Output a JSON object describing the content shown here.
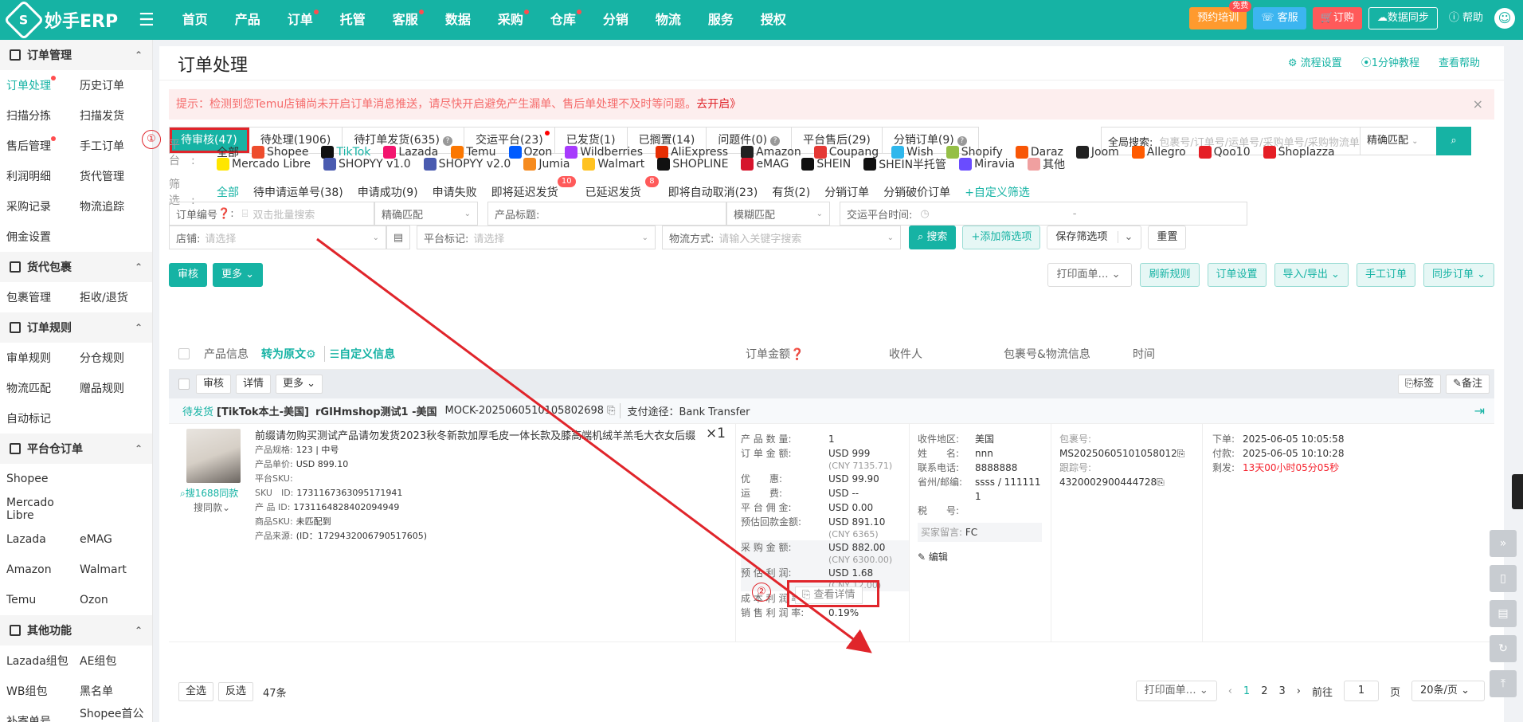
{
  "brand": {
    "name": "妙手ERP"
  },
  "topnav": [
    {
      "label": "首页",
      "dot": false
    },
    {
      "label": "产品",
      "dot": false
    },
    {
      "label": "订单",
      "dot": true
    },
    {
      "label": "托管",
      "dot": false
    },
    {
      "label": "客服",
      "dot": true
    },
    {
      "label": "数据",
      "dot": false
    },
    {
      "label": "采购",
      "dot": true
    },
    {
      "label": "仓库",
      "dot": true
    },
    {
      "label": "分销",
      "dot": false
    },
    {
      "label": "物流",
      "dot": false
    },
    {
      "label": "服务",
      "dot": false
    },
    {
      "label": "授权",
      "dot": false
    }
  ],
  "topright": {
    "training": "预约培训",
    "training_badge": "免费",
    "service": "客服",
    "subscribe": "订购",
    "sync": "数据同步",
    "help": "帮助"
  },
  "sidebar": {
    "groups": [
      {
        "title": "订单管理",
        "rows": [
          [
            "订单处理",
            "历史订单"
          ],
          [
            "扫描分拣",
            "扫描发货"
          ],
          [
            "售后管理",
            "手工订单"
          ],
          [
            "利润明细",
            "货代管理"
          ],
          [
            "采购记录",
            "物流追踪"
          ],
          [
            "佣金设置",
            ""
          ]
        ]
      },
      {
        "title": "货代包裹",
        "rows": [
          [
            "包裹管理",
            "拒收/退货"
          ]
        ]
      },
      {
        "title": "订单规则",
        "rows": [
          [
            "审单规则",
            "分仓规则"
          ],
          [
            "物流匹配",
            "赠品规则"
          ],
          [
            "自动标记",
            ""
          ]
        ]
      },
      {
        "title": "平台仓订单",
        "rows": [
          [
            "Shopee",
            ""
          ],
          [
            "Mercado Libre",
            ""
          ],
          [
            "Lazada",
            "eMAG"
          ],
          [
            "Amazon",
            "Walmart"
          ],
          [
            "Temu",
            "Ozon"
          ]
        ]
      },
      {
        "title": "其他功能",
        "rows": [
          [
            "Lazada组包",
            "AE组包"
          ],
          [
            "WB组包",
            "黑名单"
          ],
          [
            "补寄单号",
            "Shopee首公里"
          ]
        ]
      }
    ]
  },
  "page": {
    "title": "订单处理",
    "links": [
      "流程设置",
      "1分钟教程",
      "查看帮助"
    ],
    "alert_text": "提示：检测到您Temu店铺尚未开启订单消息推送，请尽快开启避免产生漏单、售后单处理不及时等问题。",
    "alert_link": "去开启》",
    "alert_close": "×"
  },
  "tabs": [
    {
      "label": "待审核(47)",
      "active": true,
      "q": false,
      "dot": false
    },
    {
      "label": "待处理(1906)",
      "active": false,
      "q": false,
      "dot": false
    },
    {
      "label": "待打单发货(635)",
      "active": false,
      "q": true,
      "dot": false
    },
    {
      "label": "交运平台(23)",
      "active": false,
      "q": false,
      "dot": true
    },
    {
      "label": "已发货(1)",
      "active": false,
      "q": false,
      "dot": false
    },
    {
      "label": "已搁置(14)",
      "active": false,
      "q": false,
      "dot": false
    },
    {
      "label": "问题件(0)",
      "active": false,
      "q": true,
      "dot": false
    },
    {
      "label": "平台售后(29)",
      "active": false,
      "q": false,
      "dot": false
    },
    {
      "label": "分销订单(9)",
      "active": false,
      "q": true,
      "dot": false
    }
  ],
  "markers": {
    "one": "①",
    "two": "②"
  },
  "global_search": {
    "label": "全局搜索:",
    "placeholder": "包裹号/订单号/运单号/采购单号/采购物流单号",
    "match": "精确匹配"
  },
  "platforms": {
    "label": "平台:",
    "row1": [
      {
        "name": "全部",
        "color": "",
        "active": false
      },
      {
        "name": "Shopee",
        "color": "#ee4d2d",
        "active": false
      },
      {
        "name": "TikTok",
        "color": "#111111",
        "active": true
      },
      {
        "name": "Lazada",
        "color": "#f3156e",
        "active": false
      },
      {
        "name": "Temu",
        "color": "#fb7701",
        "active": false
      },
      {
        "name": "Ozon",
        "color": "#005bff",
        "active": false
      },
      {
        "name": "Wildberries",
        "color": "#a73afd",
        "active": false
      },
      {
        "name": "AliExpress",
        "color": "#e62e04",
        "active": false
      },
      {
        "name": "Amazon",
        "color": "#222222",
        "active": false
      },
      {
        "name": "Coupang",
        "color": "#e53935",
        "active": false
      },
      {
        "name": "Wish",
        "color": "#2fb7ec",
        "active": false
      },
      {
        "name": "Shopify",
        "color": "#95bf47",
        "active": false
      },
      {
        "name": "Daraz",
        "color": "#f85606",
        "active": false
      },
      {
        "name": "Joom",
        "color": "#222222",
        "active": false
      },
      {
        "name": "Allegro",
        "color": "#ff5a00",
        "active": false
      },
      {
        "name": "Qoo10",
        "color": "#e51e25",
        "active": false
      },
      {
        "name": "Shoplazza",
        "color": "#e51e25",
        "active": false
      }
    ],
    "row2": [
      {
        "name": "Mercado Libre",
        "color": "#ffe600"
      },
      {
        "name": "SHOPYY v1.0",
        "color": "#4a5bb0"
      },
      {
        "name": "SHOPYY v2.0",
        "color": "#4a5bb0"
      },
      {
        "name": "Jumia",
        "color": "#f68b1e"
      },
      {
        "name": "Walmart",
        "color": "#ffc220"
      },
      {
        "name": "SHOPLINE",
        "color": "#111111"
      },
      {
        "name": "eMAG",
        "color": "#d6142c"
      },
      {
        "name": "SHEIN",
        "color": "#111111"
      },
      {
        "name": "SHEIN半托管",
        "color": "#111111"
      },
      {
        "name": "Miravia",
        "color": "#6a4cff"
      },
      {
        "name": "其他",
        "color": "#f0a0a0"
      }
    ]
  },
  "filters": {
    "label": "筛选:",
    "items": [
      {
        "label": "全部",
        "active": true,
        "count": ""
      },
      {
        "label": "待申请运单号(38)",
        "active": false,
        "count": ""
      },
      {
        "label": "申请成功(9)",
        "active": false,
        "count": ""
      },
      {
        "label": "申请失败",
        "active": false,
        "count": ""
      },
      {
        "label": "即将延迟发货",
        "active": false,
        "count": "10"
      },
      {
        "label": "已延迟发货",
        "active": false,
        "count": "8"
      },
      {
        "label": "即将自动取消(23)",
        "active": false,
        "count": ""
      },
      {
        "label": "有货(2)",
        "active": false,
        "count": ""
      },
      {
        "label": "分销订单",
        "active": false,
        "count": ""
      },
      {
        "label": "分销破价订单",
        "active": false,
        "count": ""
      }
    ],
    "custom": "+自定义筛选"
  },
  "search_row1": {
    "order_no": "订单编号",
    "batch_ph": "双击批量搜索",
    "exact": "精确匹配",
    "title_label": "产品标题:",
    "fuzzy": "模糊匹配",
    "time_label": "交运平台时间:",
    "dash": "-"
  },
  "search_row2": {
    "store": "店铺:",
    "store_ph": "请选择",
    "mark": "平台标记:",
    "mark_ph": "请选择",
    "ship": "物流方式:",
    "ship_ph": "请输入关键字搜索",
    "search": "搜索",
    "add_filter": "+添加筛选项",
    "save_filter": "保存筛选项",
    "reset": "重置"
  },
  "toolbar": {
    "audit": "审核",
    "more": "更多",
    "print": "打印面单…",
    "refresh_rules": "刷新规则",
    "order_settings": "订单设置",
    "import_export": "导入/导出",
    "manual": "手工订单",
    "sync_orders": "同步订单"
  },
  "table_head": {
    "product": "产品信息",
    "translate": "转为原文",
    "custom_info": "自定义信息",
    "amount": "订单金额",
    "receiver": "收件人",
    "package": "包裹号&物流信息",
    "time": "时间"
  },
  "sub_head": {
    "audit": "审核",
    "detail": "详情",
    "more": "更多",
    "tag": "标签",
    "remark": "备注"
  },
  "order": {
    "status": "待发货",
    "store": "[TikTok本土-美国]",
    "shop_name": "rGIHmshop测试1 -美国",
    "order_no": "MOCK-2025060510105802698",
    "payment": "支付途径：Bank Transfer",
    "product_title": "前缀请勿购买测试产品请勿发货2023秋冬新款加厚毛皮一体长款及膝高端机绒羊羔毛大衣女后缀",
    "qty": "×1",
    "find_1688": "搜1688同款",
    "same": "搜同款",
    "specs": [
      {
        "k": "产品规格:",
        "v": "123 | 中号"
      },
      {
        "k": "产品单价:",
        "v": "USD 899.10"
      },
      {
        "k": "平台SKU:",
        "v": ""
      },
      {
        "k": "SKU　ID:",
        "v": "1731167363095171941"
      },
      {
        "k": "产 品 ID:",
        "v": "1731164828402094949"
      },
      {
        "k": "商品SKU:",
        "v": "未匹配到"
      },
      {
        "k": "产品来源:",
        "v": "(ID：1729432006790517605)"
      }
    ],
    "amounts": [
      {
        "k": "产 品 数 量:",
        "v": "1",
        "sub": ""
      },
      {
        "k": "订 单 金 额:",
        "v": "USD 999",
        "sub": "(CNY 7135.71)"
      },
      {
        "k": "优　　惠:",
        "v": "USD 99.90",
        "sub": ""
      },
      {
        "k": "运　　费:",
        "v": "USD --",
        "sub": ""
      },
      {
        "k": "平 台 佣 金:",
        "v": "USD 0.00",
        "sub": ""
      },
      {
        "k": "预估回款金额:",
        "v": "USD 891.10",
        "sub": "(CNY 6365)"
      },
      {
        "k": "采 购 金 额:",
        "v": "USD 882.00",
        "sub": "(CNY 6300.00)"
      },
      {
        "k": "预 估 利 润:",
        "v": "USD 1.68",
        "sub": "(CNY 12.00)"
      },
      {
        "k": "成 本 利 润 率:",
        "v": "0.19%",
        "sub": ""
      },
      {
        "k": "销 售 利 润 率:",
        "v": "0.19%",
        "sub": ""
      }
    ],
    "view_detail": "查看详情",
    "receiver": [
      {
        "k": "收件地区:",
        "v": "美国"
      },
      {
        "k": "姓　　名:",
        "v": "nnn"
      },
      {
        "k": "联系电话:",
        "v": "8888888"
      },
      {
        "k": "省州/邮编:",
        "v": "ssss / 1111111"
      },
      {
        "k": "税　　号:",
        "v": ""
      }
    ],
    "buyer_note_label": "买家留言:",
    "buyer_note": "FC",
    "edit": "编辑",
    "package_label": "包裹号:",
    "package_no": "MS20250605101058012",
    "tracking_label": "跟踪号:",
    "tracking_no": "4320002900444728",
    "times": [
      {
        "k": "下单:",
        "v": "2025-06-05 10:05:58",
        "red": false
      },
      {
        "k": "付款:",
        "v": "2025-06-05 10:10:28",
        "red": false
      },
      {
        "k": "剩发:",
        "v": "13天00小时05分05秒",
        "red": true
      }
    ]
  },
  "footer": {
    "select_all": "全选",
    "invert": "反选",
    "count": "47条",
    "print": "打印面单…",
    "pages": [
      "1",
      "2",
      "3"
    ],
    "goto": "前往",
    "page_value": "1",
    "page_unit": "页",
    "page_size": "20条/页"
  }
}
